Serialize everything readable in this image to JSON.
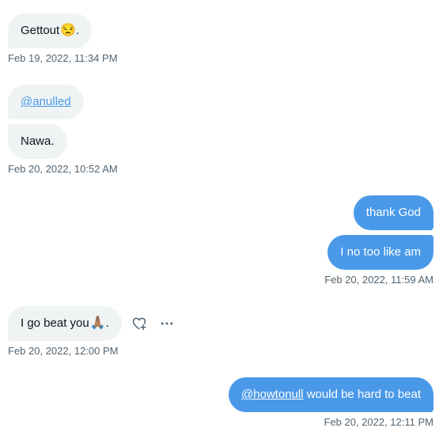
{
  "messages": [
    {
      "text": "Gettout",
      "emoji": "😒",
      "suffix": ".",
      "timestamp": "Feb 19, 2022, 11:34 PM"
    },
    {
      "mention": "@anulled"
    },
    {
      "text": "Nawa.",
      "timestamp": "Feb 20, 2022, 10:52 AM"
    },
    {
      "text": "thank God"
    },
    {
      "text": "I no too like am",
      "timestamp": "Feb 20, 2022, 11:59 AM"
    },
    {
      "text": "I go beat you",
      "emoji": "🙏🏽",
      "suffix": ".",
      "timestamp": "Feb 20, 2022, 12:00 PM"
    },
    {
      "mention": "@howtonull",
      "text": " would be hard to beat",
      "timestamp": "Feb 20, 2022, 12:11 PM"
    }
  ],
  "actions": {
    "react_icon": "heart-plus-icon",
    "more_icon": "more-horizontal-icon"
  },
  "colors": {
    "outgoing_bubble": "#4a99e9",
    "incoming_bubble": "#eff3f4",
    "timestamp": "#536471",
    "mention_link": "#4a99e9"
  }
}
